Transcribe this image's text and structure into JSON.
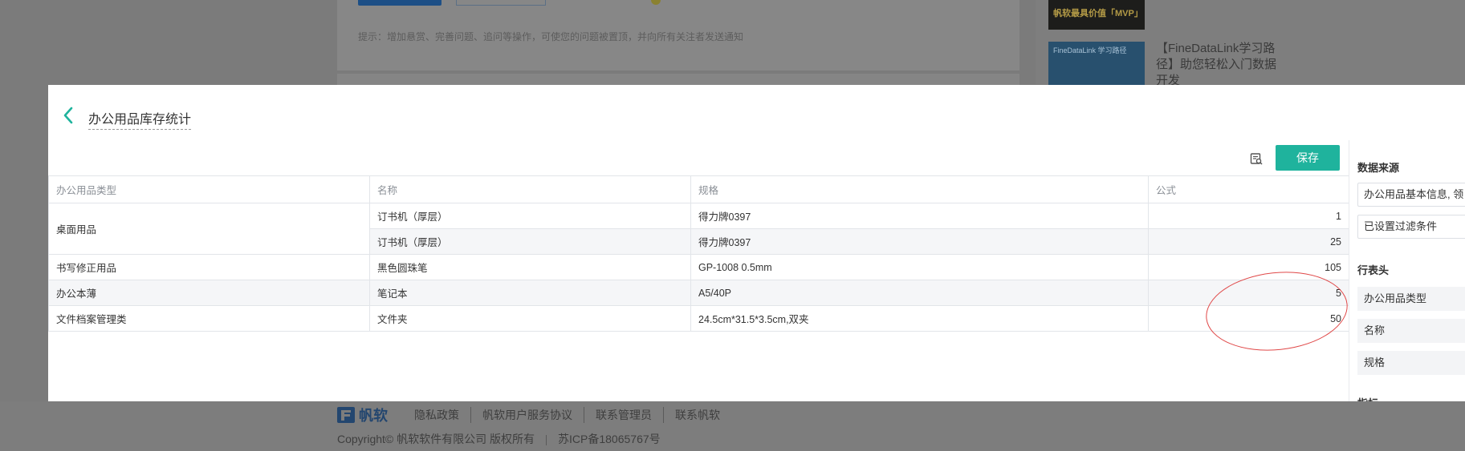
{
  "background": {
    "tip": "提示：增加悬赏、完善问题、追问等操作，可使您的问题被置顶，并向所有关注者发送通知",
    "promo_banner_text": "帆软最具价值「MVP」",
    "promo_small_text": "FineDataLink 学习路径",
    "article_title": "【FineDataLink学习路径】助您轻松入门数据开发",
    "footer": {
      "logo": "帆软",
      "links": [
        "隐私政策",
        "帆软用户服务协议",
        "联系管理员",
        "联系帆软"
      ],
      "copyright": "Copyright© 帆软软件有限公司 版权所有",
      "icp": "苏ICP备18065767号"
    }
  },
  "modal": {
    "title": "办公用品库存统计",
    "save_label": "保存",
    "accent_color": "#1fb39d",
    "table": {
      "headers": [
        "办公用品类型",
        "名称",
        "规格",
        "公式"
      ],
      "groups": [
        {
          "type": "桌面用品",
          "rows": [
            {
              "name": "订书机（厚层）",
              "spec": "得力牌0397",
              "value": "1"
            },
            {
              "name": "订书机（厚层）",
              "spec": "得力牌0397",
              "value": "25"
            }
          ]
        },
        {
          "type": "书写修正用品",
          "rows": [
            {
              "name": "黑色圆珠笔",
              "spec": "GP-1008 0.5mm",
              "value": "105"
            }
          ]
        },
        {
          "type": "办公本薄",
          "rows": [
            {
              "name": "笔记本",
              "spec": "A5/40P",
              "value": "5"
            }
          ]
        },
        {
          "type": "文件档案管理类",
          "rows": [
            {
              "name": "文件夹",
              "spec": "24.5cm*31.5*3.5cm,双夹",
              "value": "50"
            }
          ]
        }
      ]
    },
    "side": {
      "data_source_label": "数据来源",
      "data_source_value": "办公用品基本信息, 领",
      "filter_status": "已设置过滤条件",
      "row_header_label": "行表头",
      "row_headers": [
        "办公用品类型",
        "名称",
        "规格"
      ],
      "next_section_label": "指标"
    }
  }
}
